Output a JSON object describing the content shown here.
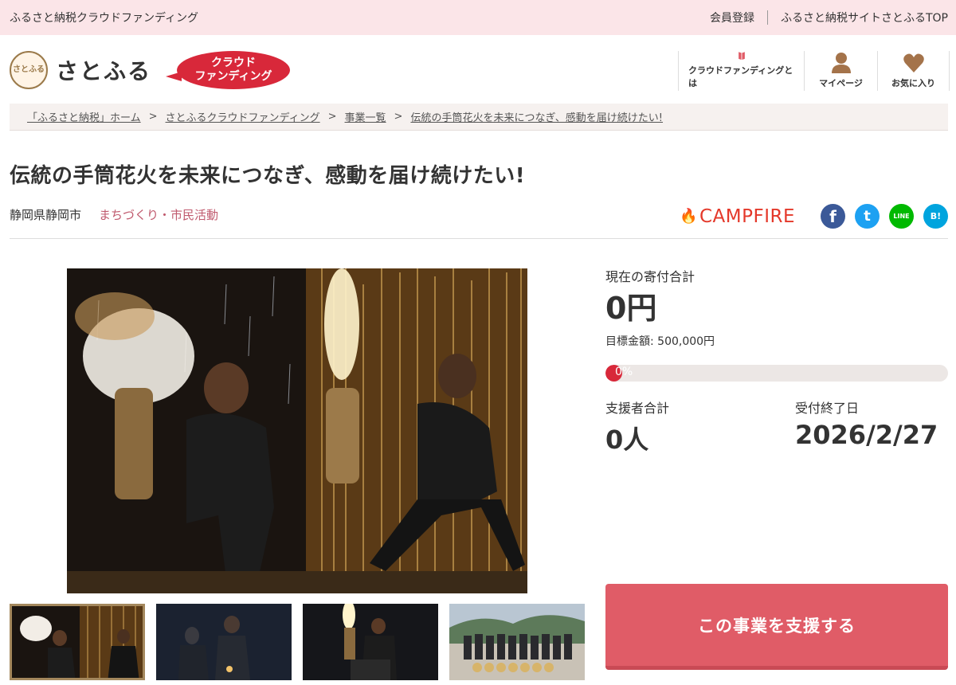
{
  "topbar": {
    "site_label": "ふるさと納税クラウドファンディング",
    "register": "会員登録",
    "top_link": "ふるさと納税サイトさとふるTOP"
  },
  "header": {
    "logo_mark": "さとふる",
    "logo_text": "さとふる",
    "badge_line1": "クラウド",
    "badge_line2": "ファンディング",
    "nav": [
      {
        "label": "クラウドファンディングとは",
        "icon": "book-icon"
      },
      {
        "label": "マイページ",
        "icon": "user-icon"
      },
      {
        "label": "お気に入り",
        "icon": "heart-icon"
      }
    ]
  },
  "breadcrumb": [
    "「ふるさと納税」ホーム",
    "さとふるクラウドファンディング",
    "事業一覧",
    "伝統の手筒花火を未来につなぎ、感動を届け続けたい!"
  ],
  "breadcrumb_sep": ">",
  "project": {
    "title": "伝統の手筒花火を未来につなぎ、感動を届け続けたい!",
    "prefecture": "静岡県静岡市",
    "category": "まちづくり・市民活動"
  },
  "share": {
    "partner": "CAMPFIRE",
    "icons": [
      {
        "name": "facebook-icon",
        "glyph": "f",
        "color": "#3b5998"
      },
      {
        "name": "twitter-icon",
        "glyph": "t",
        "color": "#1da1f2"
      },
      {
        "name": "line-icon",
        "glyph": "LINE",
        "color": "#00b900"
      },
      {
        "name": "hatena-icon",
        "glyph": "B!",
        "color": "#00a4de"
      }
    ]
  },
  "stats": {
    "total_label": "現在の寄付合計",
    "total_value": "0円",
    "goal_text": "目標金額: 500,000円",
    "progress_label": "0%",
    "progress_fraction": 0,
    "supporters_label": "支援者合計",
    "supporters_value": "0人",
    "deadline_label": "受付終了日",
    "deadline_value": "2026/2/27"
  },
  "cta": {
    "label": "この事業を支援する"
  },
  "colors": {
    "brand_red": "#d8283a",
    "cta": "#e05c67",
    "topbar_bg": "#fbe5e8",
    "category": "#c05a6e"
  }
}
